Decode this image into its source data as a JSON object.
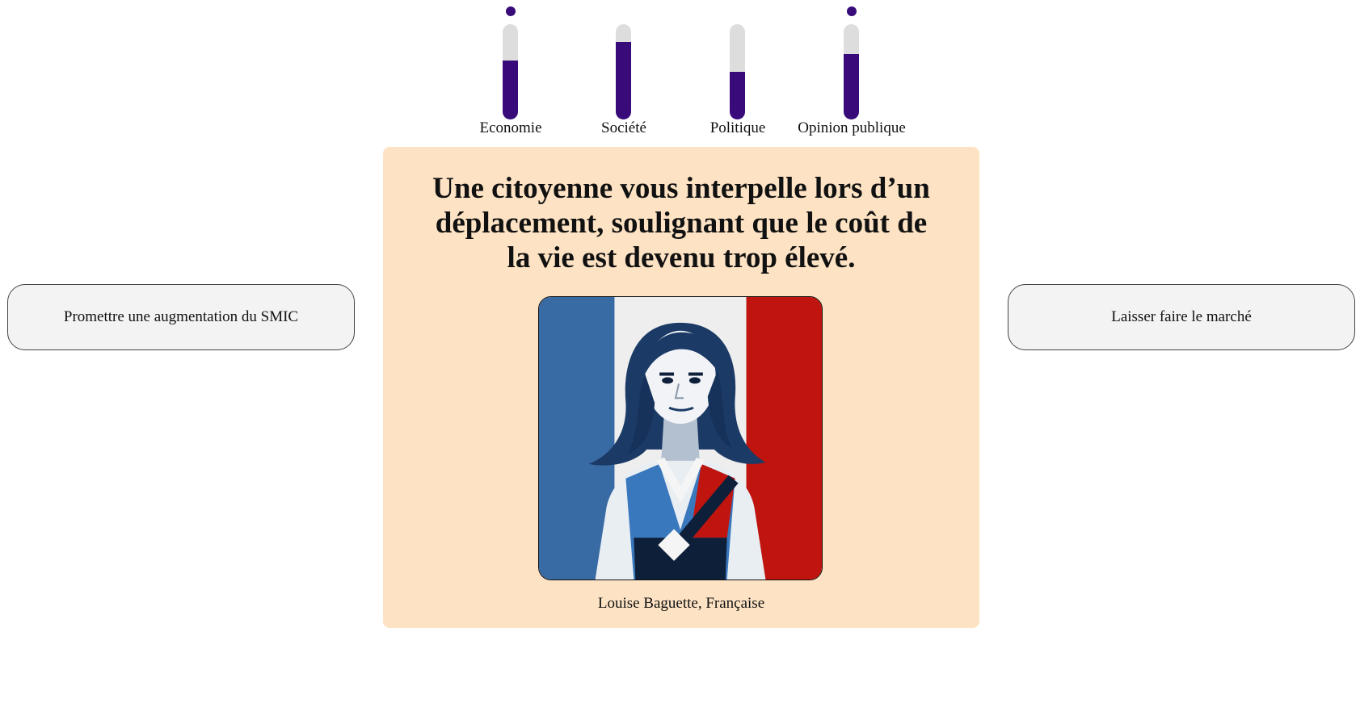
{
  "gauges": [
    {
      "label": "Economie",
      "level": 0.62,
      "indicator": true
    },
    {
      "label": "Société",
      "level": 0.81,
      "indicator": false
    },
    {
      "label": "Politique",
      "level": 0.5,
      "indicator": false
    },
    {
      "label": "Opinion publique",
      "level": 0.69,
      "indicator": true
    }
  ],
  "card": {
    "question": "Une citoyenne vous interpelle lors d’un déplacement, soulignant que le coût de la vie est devenu trop élevé.",
    "character": "Louise Baguette, Française"
  },
  "choices": {
    "left": "Promettre une augmentation du SMIC",
    "right": "Laisser faire le marché"
  },
  "colors": {
    "gauge_fill": "#380a7a",
    "gauge_track": "#dddddd",
    "card_background": "#fde3c4",
    "button_background": "#f3f3f3",
    "flag_blue": "#386aa4",
    "flag_white": "#eeeeee",
    "flag_red": "#c0140f"
  }
}
